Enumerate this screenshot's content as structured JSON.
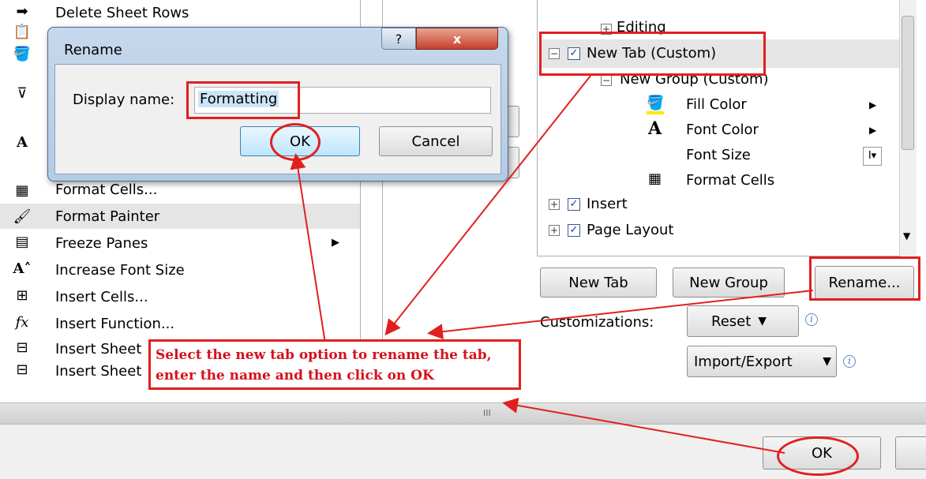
{
  "commands": [
    {
      "label": "Delete Sheet Rows",
      "icon": "delete-rows-icon"
    },
    {
      "label": "Format Cells...",
      "icon": "format-cells-icon"
    },
    {
      "label": "Format Painter",
      "icon": "format-painter-icon"
    },
    {
      "label": "Freeze Panes",
      "icon": "freeze-panes-icon"
    },
    {
      "label": "Increase Font Size",
      "icon": "increase-font-icon"
    },
    {
      "label": "Insert Cells...",
      "icon": "insert-cells-icon"
    },
    {
      "label": "Insert Function...",
      "icon": "insert-function-icon"
    },
    {
      "label": "Insert Sheet",
      "icon": "insert-sheet-icon"
    },
    {
      "label": "Insert Sheet",
      "icon": "insert-sheet-cols-icon"
    }
  ],
  "dialog": {
    "title": "Rename",
    "help_glyph": "?",
    "close_glyph": "x",
    "field_label": "Display name:",
    "field_value": "Formatting",
    "ok_label": "OK",
    "cancel_label": "Cancel"
  },
  "tree": {
    "editing": "Editing",
    "new_tab": "New Tab (Custom)",
    "new_group": "New Group (Custom)",
    "fill_color": "Fill Color",
    "font_color": "Font Color",
    "font_size": "Font Size",
    "format_cells": "Format Cells",
    "insert": "Insert",
    "page_layout": "Page Layout"
  },
  "buttons": {
    "new_tab": "New Tab",
    "new_group": "New Group",
    "rename": "Rename...",
    "reset": "Reset",
    "import_export": "Import/Export",
    "ok": "OK"
  },
  "customizations_label": "Customizations:",
  "splitter_glyph": "III",
  "annotation": "Select the new tab option to rename the tab, enter the name and then click on OK",
  "colors": {
    "annotation_red": "#e0201f",
    "selection": "#cde4f7",
    "highlight_row": "#e5e5e5"
  }
}
